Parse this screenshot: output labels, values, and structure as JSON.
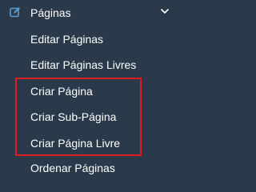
{
  "menu": {
    "title": "Páginas",
    "icon": "edit-icon",
    "expanded_icon": "chevron-down-icon",
    "items": [
      {
        "label": "Editar Páginas"
      },
      {
        "label": "Editar Páginas Livres"
      },
      {
        "label": "Criar Página"
      },
      {
        "label": "Criar Sub-Página"
      },
      {
        "label": "Criar Página Livre"
      },
      {
        "label": "Ordenar Páginas"
      }
    ]
  },
  "colors": {
    "background": "#2a3a4b",
    "text": "#ffffff",
    "icon_accent": "#5b9bd5",
    "highlight_border": "#e01b22"
  }
}
